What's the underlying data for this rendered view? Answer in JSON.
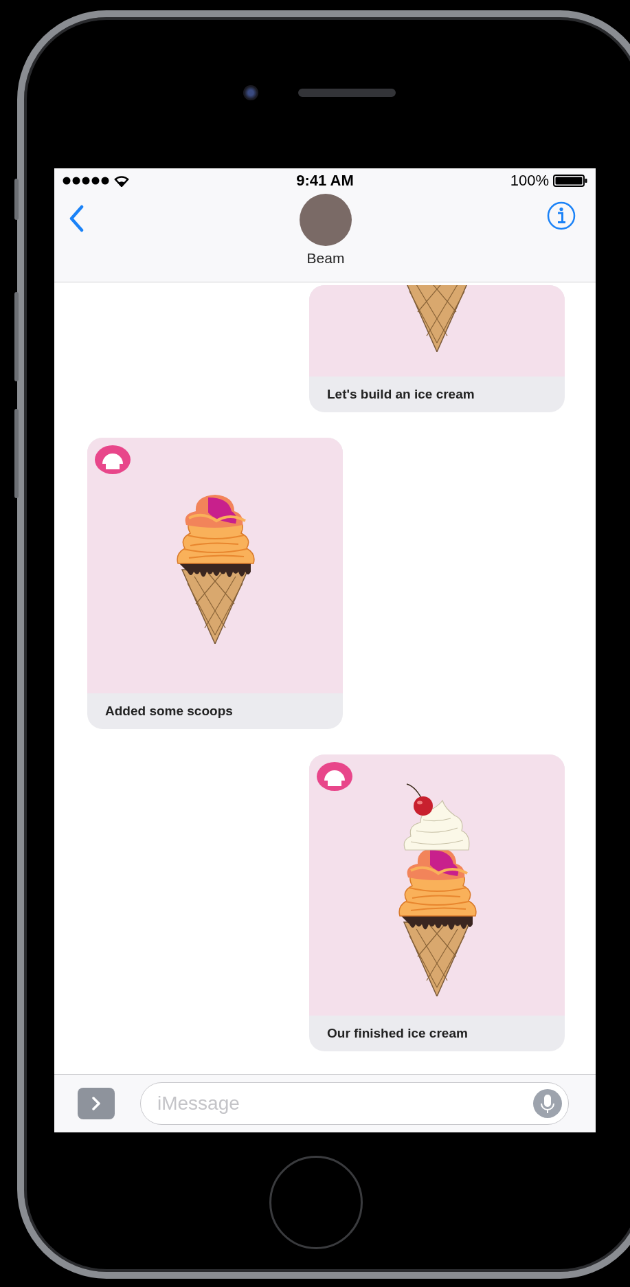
{
  "status_bar": {
    "time": "9:41 AM",
    "battery": "100%"
  },
  "contact": {
    "name": "Beam"
  },
  "messages": [
    {
      "sent": true,
      "kind": "cone",
      "cropped": true,
      "caption": "Let's build an ice cream"
    },
    {
      "sent": false,
      "kind": "scoops",
      "cropped": false,
      "caption": "Added some scoops"
    },
    {
      "sent": true,
      "kind": "finished",
      "cropped": false,
      "caption": "Our finished ice cream"
    }
  ],
  "composer": {
    "placeholder": "iMessage"
  }
}
